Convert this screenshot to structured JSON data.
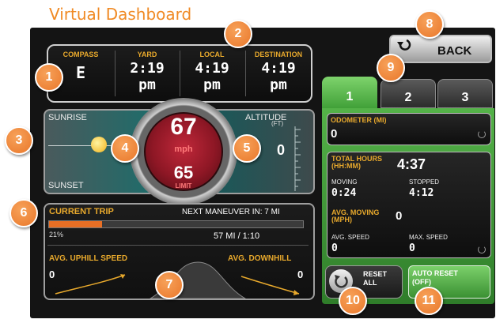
{
  "page_title": "Virtual Dashboard",
  "time_panel": {
    "compass": {
      "label": "COMPASS",
      "value": "E"
    },
    "yard": {
      "label": "YARD",
      "value_time": "2:19",
      "value_ampm": "pm"
    },
    "local": {
      "label": "LOCAL",
      "value_time": "4:19",
      "value_ampm": "pm"
    },
    "destination": {
      "label": "DESTINATION",
      "value_time": "4:19",
      "value_ampm": "pm"
    }
  },
  "sun_panel": {
    "sunrise": "SUNRISE",
    "sunset": "SUNSET",
    "altitude_label": "ALTITUDE",
    "altitude_unit": "(FT)",
    "altitude_value": "0"
  },
  "gauge": {
    "speed": "67",
    "speed_unit": "mph",
    "limit": "65",
    "limit_label": "LIMIT"
  },
  "trip": {
    "title": "CURRENT TRIP",
    "next_maneuver": "NEXT MANEUVER IN: 7 MI",
    "progress_percent": 21,
    "progress_label": "21%",
    "distance": "57 MI / 1:10",
    "uphill_label": "AVG. UPHILL SPEED",
    "uphill_value": "0",
    "downhill_label": "AVG. DOWNHILL",
    "downhill_value": "0"
  },
  "back": {
    "label": "BACK"
  },
  "tabs": [
    {
      "label": "1"
    },
    {
      "label": "2"
    },
    {
      "label": "3"
    }
  ],
  "stats": {
    "odometer_label": "ODOMETER (MI)",
    "odometer_value": "0",
    "total_hours_label_1": "TOTAL HOURS",
    "total_hours_label_2": "(HH:MM)",
    "total_hours_value": "4:37",
    "moving_label": "MOVING",
    "moving_value": "0:24",
    "stopped_label": "STOPPED",
    "stopped_value": "4:12",
    "avg_moving_label_1": "AVG. MOVING",
    "avg_moving_label_2": "(MPH)",
    "avg_moving_value": "0",
    "avg_speed_label": "AVG. SPEED",
    "avg_speed_value": "0",
    "max_speed_label": "MAX. SPEED",
    "max_speed_value": "0"
  },
  "reset_all": {
    "line1": "RESET",
    "line2": "ALL"
  },
  "auto_reset": {
    "line1": "AUTO RESET",
    "line2": "(OFF)"
  },
  "callouts": [
    "1",
    "2",
    "3",
    "4",
    "5",
    "6",
    "7",
    "8",
    "9",
    "10",
    "11"
  ],
  "colors": {
    "accent_orange": "#e8a92c",
    "callout_orange": "#e9772a",
    "tab_green": "#4fae44",
    "gauge_red": "#a01c2b",
    "teal": "#1f6c6a"
  },
  "icons": {
    "back": "back-arrow-icon",
    "reset": "reset-icon",
    "sun": "sun-icon"
  }
}
